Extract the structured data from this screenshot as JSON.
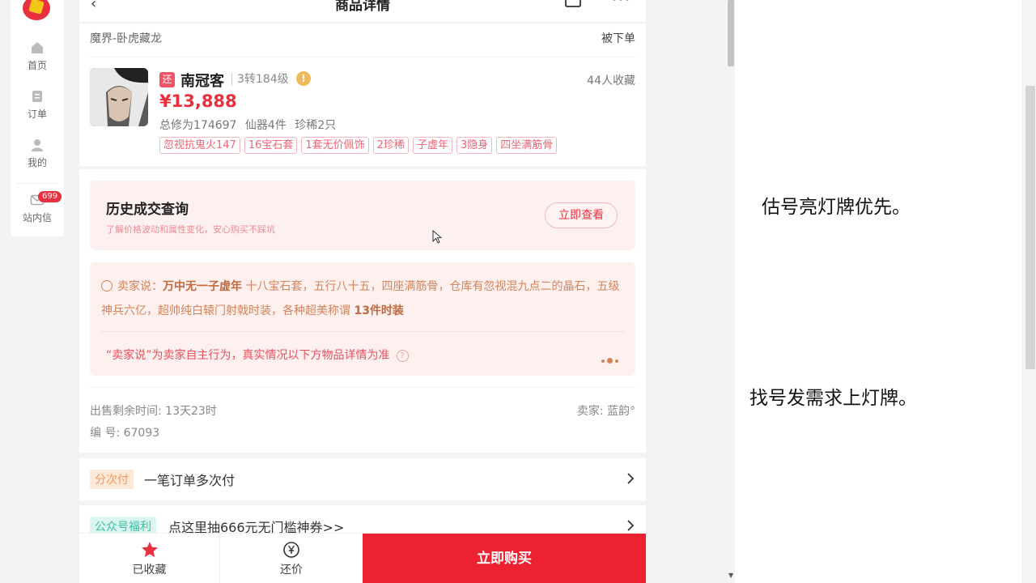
{
  "rail": {
    "items": [
      {
        "label": "首页",
        "icon": "home-icon"
      },
      {
        "label": "订单",
        "icon": "order-icon"
      },
      {
        "label": "我的",
        "icon": "user-icon"
      },
      {
        "label": "站内信",
        "icon": "mail-icon",
        "badge": "699"
      }
    ]
  },
  "header": {
    "title": "商品详情",
    "back_glyph": "‹"
  },
  "product": {
    "server": "魔界-卧虎藏龙",
    "status": "被下单",
    "tag": "还",
    "name": "南冠客",
    "level": "3转184级",
    "favorites": "44人收藏",
    "price": "¥13,888",
    "stats": [
      "总修为174697",
      "仙器4件",
      "珍稀2只"
    ],
    "tags": [
      "忽视抗鬼火147",
      "16宝石套",
      "1套无价佩饰",
      "2珍稀",
      "子虚年",
      "3隐身",
      "四坐满筋骨"
    ]
  },
  "history": {
    "title": "历史成交查询",
    "subtitle": "了解价格波动和属性变化，安心购买不踩坑",
    "button": "立即查看"
  },
  "seller_says": {
    "prefix": "卖家说：",
    "highlight": "万中无一子虚年",
    "text": " 十八宝石套，五行八十五，四座满筋骨，仓库有忽视混九点二的晶石，五级神兵六亿，超帅纯白辕门射戟时装，各种超美称谓 ",
    "highlight2": "13件时装",
    "disclaimer": "“卖家说”为卖家自主行为，真实情况以下方物品详情为准",
    "help": "?"
  },
  "meta": {
    "remaining": "出售剩余时间: 13天23时",
    "seller": "卖家: 蓝韵°",
    "serial": "编 号: 67093"
  },
  "rows": [
    {
      "tag": "分次付",
      "text": "一笔订单多次付"
    },
    {
      "tag": "公众号福利",
      "text": "点这里抽666元无门槛神券>>"
    }
  ],
  "bottom": {
    "favorite": "已收藏",
    "bargain": "还价",
    "buy": "立即购买"
  },
  "notes": {
    "line1": "估号亮灯牌优先。",
    "line2": "找号发需求上灯牌。"
  },
  "colors": {
    "accent": "#e8303f",
    "seller_text": "#d4845a",
    "history_bg": "#fdf0f0"
  }
}
